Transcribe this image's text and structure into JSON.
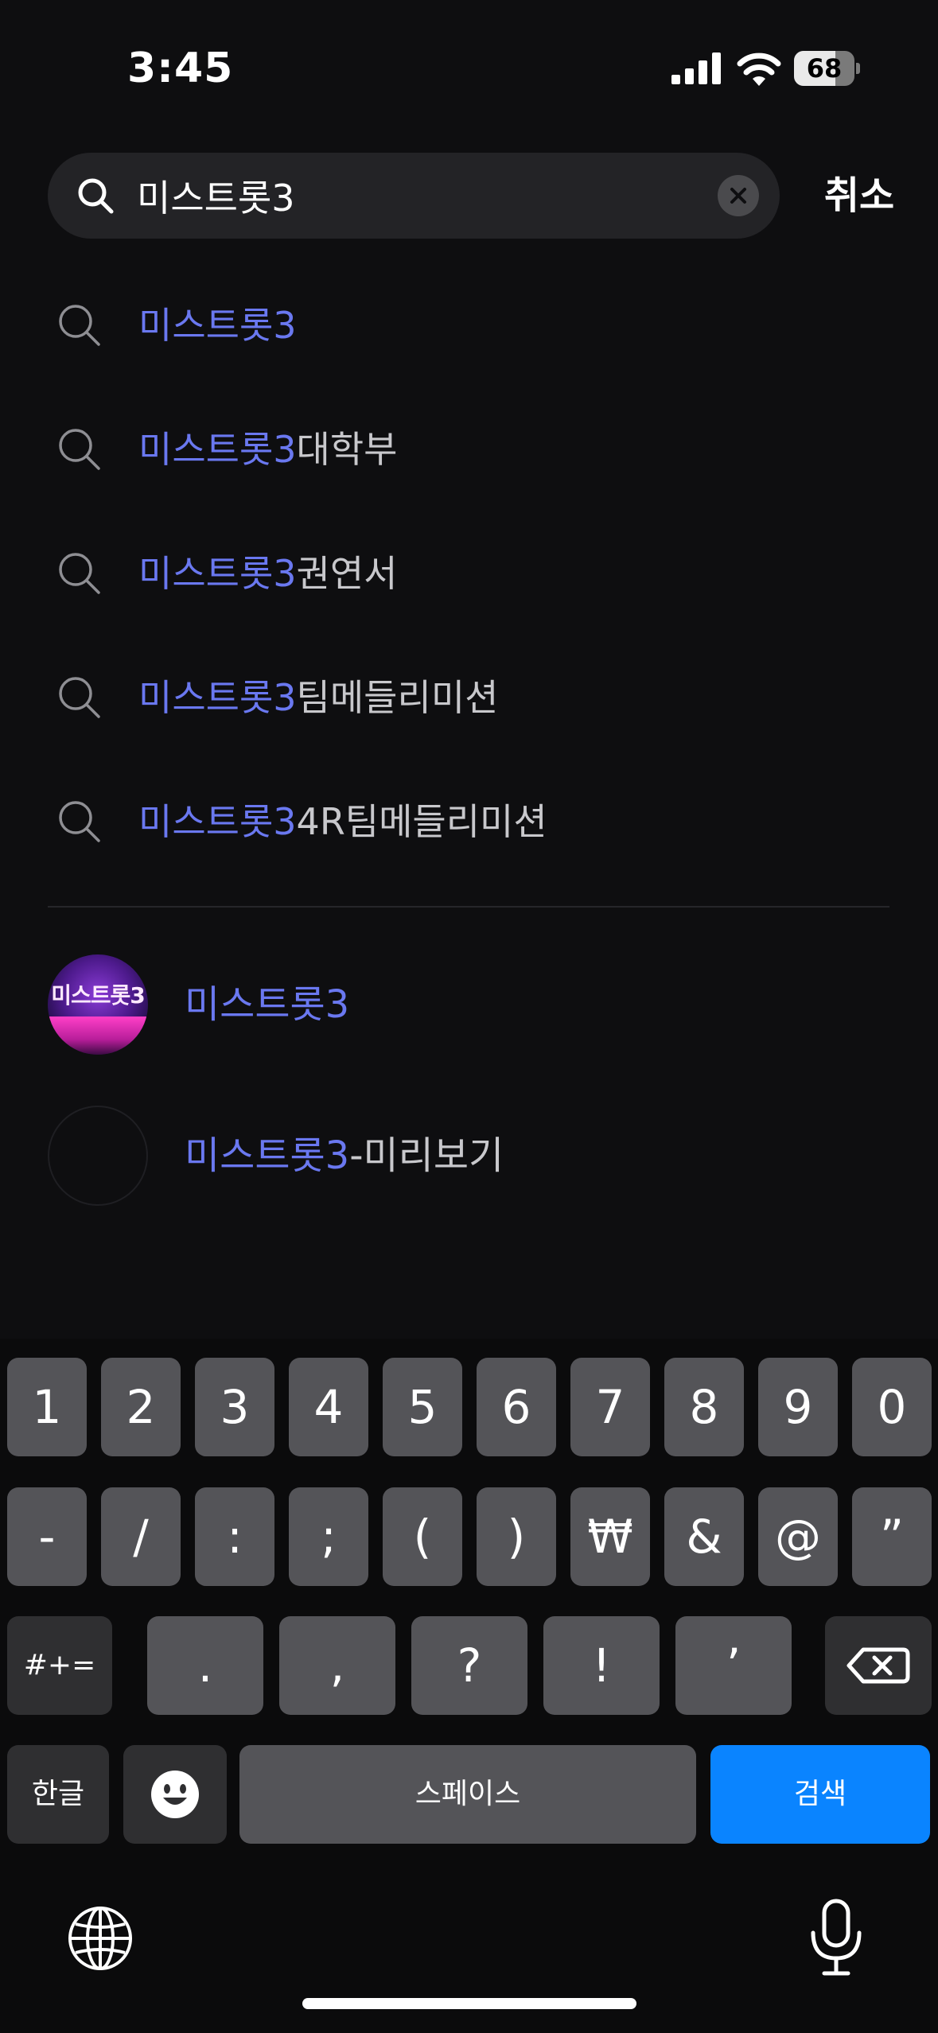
{
  "status_bar": {
    "time": "3:45",
    "battery": "68",
    "battery_level": 0.68
  },
  "search": {
    "query": "미스트롯3",
    "cancel_label": "취소"
  },
  "suggestions": [
    {
      "highlight": "미스트롯3",
      "rest": ""
    },
    {
      "highlight": "미스트롯3",
      "rest": "대학부"
    },
    {
      "highlight": "미스트롯3",
      "rest": "권연서"
    },
    {
      "highlight": "미스트롯3",
      "rest": "팀메들리미션"
    },
    {
      "highlight": "미스트롯3",
      "rest": "4R팀메들리미션"
    }
  ],
  "channels": [
    {
      "highlight": "미스트롯3",
      "rest": "",
      "avatar_text": "미스트롯3"
    },
    {
      "highlight": "미스트롯3",
      "rest": "-미리보기"
    }
  ],
  "keyboard": {
    "row1": [
      "1",
      "2",
      "3",
      "4",
      "5",
      "6",
      "7",
      "8",
      "9",
      "0"
    ],
    "row2": [
      "-",
      "/",
      ":",
      ";",
      "(",
      ")",
      "₩",
      "&",
      "@",
      "”"
    ],
    "row3": [
      "#+=",
      ".",
      ",",
      "?",
      "!",
      "’"
    ],
    "lang_key": "한글",
    "space_key": "스페이스",
    "search_key": "검색"
  },
  "colors": {
    "highlight": "#6a78f0",
    "accent": "#0a84ff",
    "background": "#0e0e10"
  }
}
